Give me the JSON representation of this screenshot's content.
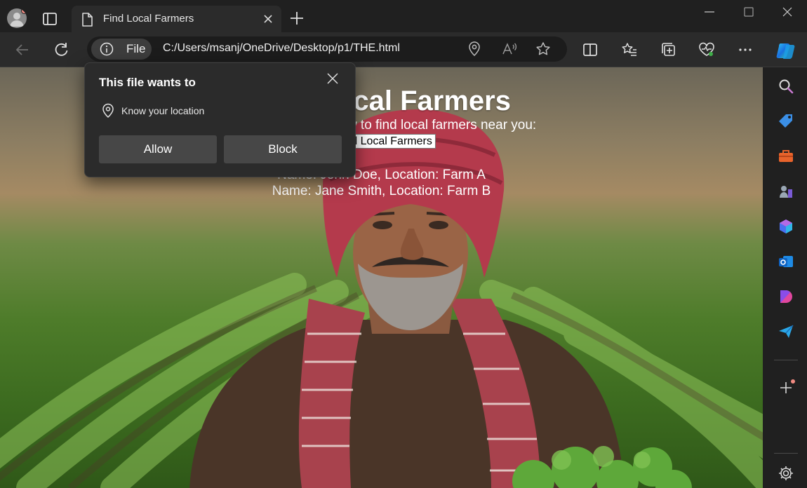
{
  "browser": {
    "tab": {
      "title": "Find Local Farmers"
    },
    "address_bar": {
      "site_chip_label": "File",
      "url": "C:/Users/msanj/OneDrive/Desktop/p1/THE.html"
    }
  },
  "permission_popup": {
    "title": "This file wants to",
    "permission": "Know your location",
    "allow_label": "Allow",
    "block_label": "Block"
  },
  "page": {
    "heading": "Find Local Farmers",
    "intro": "Click the button below to find local farmers near you:",
    "button_label": "Find Local Farmers",
    "farmers": [
      "Name: John Doe, Location: Farm A",
      "Name: Jane Smith, Location: Farm B"
    ]
  },
  "icons": {
    "toolbar": [
      "back-icon",
      "refresh-icon",
      "info-icon",
      "location-icon",
      "read-aloud-icon",
      "favorite-star-icon",
      "split-screen-icon",
      "favorites-icon",
      "collections-icon",
      "browser-essentials-icon",
      "more-icon",
      "copilot-icon"
    ],
    "sidebar": [
      "search-icon",
      "shopping-tag-icon",
      "tools-icon",
      "games-icon",
      "copilot-app-icon",
      "outlook-icon",
      "designer-icon",
      "send-icon",
      "add-icon",
      "settings-icon"
    ]
  },
  "colors": {
    "chrome_bg": "#202020",
    "toolbar_bg": "#2b2b2b",
    "popup_button": "#474747",
    "notification_dot": "#f28b82"
  }
}
